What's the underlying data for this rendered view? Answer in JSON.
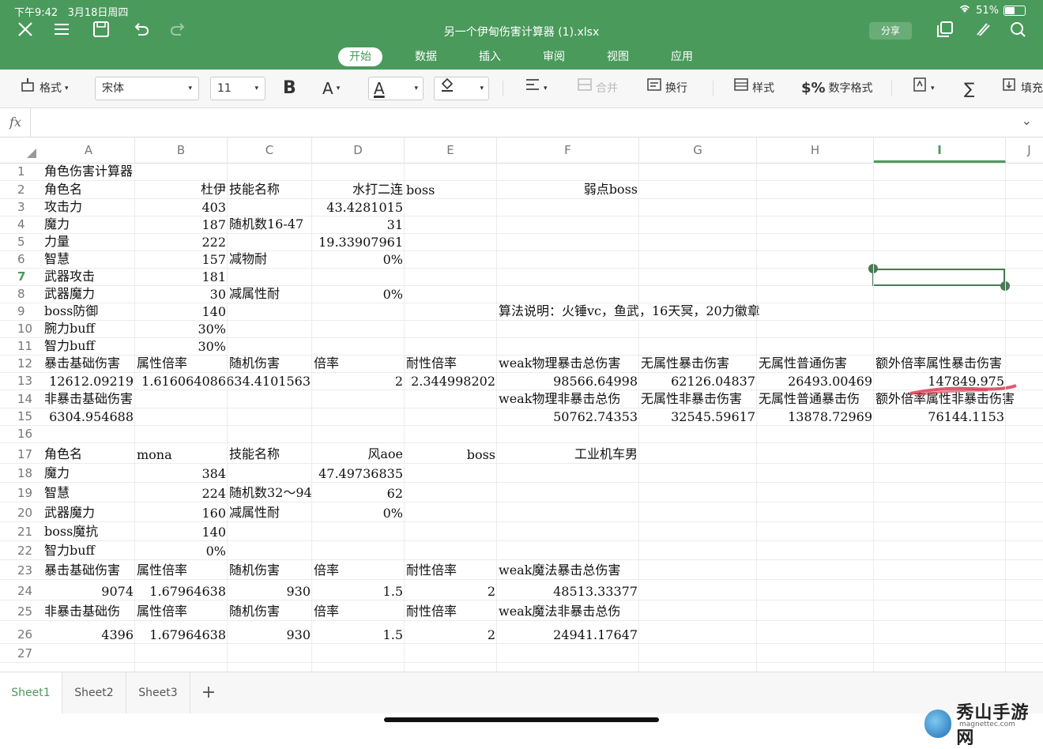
{
  "status": {
    "time": "下午9:42",
    "date": "3月18日周四",
    "battery": "51%"
  },
  "title_bar": {
    "doc_title": "另一个伊甸伤害计算器 (1).xlsx",
    "share_label": "分享"
  },
  "tabs": [
    "开始",
    "数据",
    "插入",
    "审阅",
    "视图",
    "应用"
  ],
  "toolbar": {
    "format_label": "格式",
    "font": "宋体",
    "font_size": "11",
    "bold": "B",
    "font_size_adjust": "A",
    "font_color": "A",
    "merge_label": "合并",
    "wrap_label": "换行",
    "style_label": "样式",
    "number_format_label": "数字格式",
    "fill_label": "填充"
  },
  "formula_bar": {
    "label": "fx",
    "value": ""
  },
  "columns": [
    "A",
    "B",
    "C",
    "D",
    "E",
    "F",
    "G",
    "H",
    "I",
    "J"
  ],
  "selected": {
    "column": "I",
    "row": "7"
  },
  "rows": [
    {
      "n": "1",
      "cells": [
        {
          "c": "A",
          "v": "角色伤害计算器"
        }
      ]
    },
    {
      "n": "2",
      "cells": [
        {
          "c": "A",
          "v": "角色名"
        },
        {
          "c": "B",
          "v": "杜伊",
          "r": true
        },
        {
          "c": "C",
          "v": "技能名称"
        },
        {
          "c": "D",
          "v": "水打二连",
          "r": true
        },
        {
          "c": "E",
          "v": "boss"
        },
        {
          "c": "F",
          "v": "弱点boss",
          "r": true
        }
      ]
    },
    {
      "n": "3",
      "cells": [
        {
          "c": "A",
          "v": "攻击力"
        },
        {
          "c": "B",
          "v": "403",
          "r": true
        },
        {
          "c": "D",
          "v": "43.4281015",
          "r": true
        }
      ]
    },
    {
      "n": "4",
      "cells": [
        {
          "c": "A",
          "v": "魔力"
        },
        {
          "c": "B",
          "v": "187",
          "r": true
        },
        {
          "c": "C",
          "v": "随机数16-47"
        },
        {
          "c": "D",
          "v": "31",
          "r": true
        }
      ]
    },
    {
      "n": "5",
      "cells": [
        {
          "c": "A",
          "v": "力量"
        },
        {
          "c": "B",
          "v": "222",
          "r": true
        },
        {
          "c": "D",
          "v": "19.33907961",
          "r": true
        }
      ]
    },
    {
      "n": "6",
      "cells": [
        {
          "c": "A",
          "v": "智慧"
        },
        {
          "c": "B",
          "v": "157",
          "r": true
        },
        {
          "c": "C",
          "v": "减物耐"
        },
        {
          "c": "D",
          "v": "0%",
          "r": true
        }
      ]
    },
    {
      "n": "7",
      "cells": [
        {
          "c": "A",
          "v": "武器攻击"
        },
        {
          "c": "B",
          "v": "181",
          "r": true
        }
      ]
    },
    {
      "n": "8",
      "cells": [
        {
          "c": "A",
          "v": "武器魔力"
        },
        {
          "c": "B",
          "v": "30",
          "r": true
        },
        {
          "c": "C",
          "v": "减属性耐"
        },
        {
          "c": "D",
          "v": "0%",
          "r": true
        }
      ]
    },
    {
      "n": "9",
      "cells": [
        {
          "c": "A",
          "v": "boss防御"
        },
        {
          "c": "B",
          "v": "140",
          "r": true
        },
        {
          "c": "F",
          "v": "算法说明：火锤vc，鱼武，16天冥，20力徽章"
        }
      ]
    },
    {
      "n": "10",
      "cells": [
        {
          "c": "A",
          "v": "腕力buff"
        },
        {
          "c": "B",
          "v": "30%",
          "r": true
        }
      ]
    },
    {
      "n": "11",
      "cells": [
        {
          "c": "A",
          "v": "智力buff"
        },
        {
          "c": "B",
          "v": "30%",
          "r": true
        }
      ]
    },
    {
      "n": "12",
      "cells": [
        {
          "c": "A",
          "v": "暴击基础伤害"
        },
        {
          "c": "B",
          "v": "属性倍率"
        },
        {
          "c": "C",
          "v": "随机伤害"
        },
        {
          "c": "D",
          "v": "倍率"
        },
        {
          "c": "E",
          "v": "耐性倍率"
        },
        {
          "c": "F",
          "v": "weak物理暴击总伤害"
        },
        {
          "c": "G",
          "v": "无属性暴击伤害"
        },
        {
          "c": "H",
          "v": "无属性普通伤害"
        },
        {
          "c": "I",
          "v": "额外倍率属性暴击伤害"
        }
      ]
    },
    {
      "n": "13",
      "cells": [
        {
          "c": "A",
          "v": "12612.09219",
          "r": true
        },
        {
          "c": "B",
          "v": "1.616064086",
          "r": true
        },
        {
          "c": "C",
          "v": "634.4101563",
          "r": true
        },
        {
          "c": "D",
          "v": "2",
          "r": true
        },
        {
          "c": "E",
          "v": "2.344998202",
          "r": true
        },
        {
          "c": "F",
          "v": "98566.64998",
          "r": true
        },
        {
          "c": "G",
          "v": "62126.04837",
          "r": true
        },
        {
          "c": "H",
          "v": "26493.00469",
          "r": true
        },
        {
          "c": "I",
          "v": "147849.975",
          "r": true
        }
      ]
    },
    {
      "n": "14",
      "cells": [
        {
          "c": "A",
          "v": "非暴击基础伤害"
        },
        {
          "c": "F",
          "v": "weak物理非暴击总伤"
        },
        {
          "c": "G",
          "v": "无属性非暴击伤害"
        },
        {
          "c": "H",
          "v": "无属性普通暴击伤"
        },
        {
          "c": "I",
          "v": "额外倍率属性非暴击伤害"
        }
      ]
    },
    {
      "n": "15",
      "cells": [
        {
          "c": "A",
          "v": "6304.954688",
          "r": true
        },
        {
          "c": "F",
          "v": "50762.74353",
          "r": true
        },
        {
          "c": "G",
          "v": "32545.59617",
          "r": true
        },
        {
          "c": "H",
          "v": "13878.72969",
          "r": true
        },
        {
          "c": "I",
          "v": "76144.1153",
          "r": true
        }
      ]
    },
    {
      "n": "16",
      "cells": []
    },
    {
      "n": "17",
      "cells": [
        {
          "c": "A",
          "v": "角色名"
        },
        {
          "c": "B",
          "v": "mona"
        },
        {
          "c": "C",
          "v": "技能名称"
        },
        {
          "c": "D",
          "v": "风aoe",
          "r": true
        },
        {
          "c": "E",
          "v": "boss",
          "r": true
        },
        {
          "c": "F",
          "v": "工业机车男",
          "r": true
        }
      ]
    },
    {
      "n": "18",
      "cells": [
        {
          "c": "A",
          "v": "魔力"
        },
        {
          "c": "B",
          "v": "384",
          "r": true
        },
        {
          "c": "D",
          "v": "47.49736835",
          "r": true
        }
      ]
    },
    {
      "n": "19",
      "cells": [
        {
          "c": "A",
          "v": "智慧"
        },
        {
          "c": "B",
          "v": "224",
          "r": true
        },
        {
          "c": "C",
          "v": "随机数32～94"
        },
        {
          "c": "D",
          "v": "62",
          "r": true
        }
      ]
    },
    {
      "n": "20",
      "cells": [
        {
          "c": "A",
          "v": "武器魔力"
        },
        {
          "c": "B",
          "v": "160",
          "r": true
        },
        {
          "c": "C",
          "v": "减属性耐"
        },
        {
          "c": "D",
          "v": "0%",
          "r": true
        }
      ]
    },
    {
      "n": "21",
      "cells": [
        {
          "c": "A",
          "v": "boss魔抗"
        },
        {
          "c": "B",
          "v": "140",
          "r": true
        }
      ]
    },
    {
      "n": "22",
      "cells": [
        {
          "c": "A",
          "v": "智力buff"
        },
        {
          "c": "B",
          "v": "0%",
          "r": true
        }
      ]
    },
    {
      "n": "23",
      "cells": [
        {
          "c": "A",
          "v": "暴击基础伤害"
        },
        {
          "c": "B",
          "v": "属性倍率"
        },
        {
          "c": "C",
          "v": "随机伤害"
        },
        {
          "c": "D",
          "v": "倍率"
        },
        {
          "c": "E",
          "v": "耐性倍率"
        },
        {
          "c": "F",
          "v": "weak魔法暴击总伤害"
        }
      ]
    },
    {
      "n": "24",
      "cells": [
        {
          "c": "A",
          "v": "9074",
          "r": true
        },
        {
          "c": "B",
          "v": "1.67964638",
          "r": true
        },
        {
          "c": "C",
          "v": "930",
          "r": true
        },
        {
          "c": "D",
          "v": "1.5",
          "r": true
        },
        {
          "c": "E",
          "v": "2",
          "r": true
        },
        {
          "c": "F",
          "v": "48513.33377",
          "r": true
        }
      ]
    },
    {
      "n": "25",
      "cells": [
        {
          "c": "A",
          "v": "非暴击基础伤"
        },
        {
          "c": "B",
          "v": "属性倍率"
        },
        {
          "c": "C",
          "v": "随机伤害"
        },
        {
          "c": "D",
          "v": "倍率"
        },
        {
          "c": "E",
          "v": "耐性倍率"
        },
        {
          "c": "F",
          "v": "weak魔法非暴击总伤"
        }
      ]
    },
    {
      "n": "26",
      "cells": [
        {
          "c": "A",
          "v": "4396",
          "r": true
        },
        {
          "c": "B",
          "v": "1.67964638",
          "r": true
        },
        {
          "c": "C",
          "v": "930",
          "r": true
        },
        {
          "c": "D",
          "v": "1.5",
          "r": true
        },
        {
          "c": "E",
          "v": "2",
          "r": true
        },
        {
          "c": "F",
          "v": "24941.17647",
          "r": true
        }
      ]
    },
    {
      "n": "27",
      "cells": []
    }
  ],
  "sheets": [
    "Sheet1",
    "Sheet2",
    "Sheet3"
  ],
  "add_sheet": "+",
  "watermark": {
    "text": "秀山手游网",
    "sub": "magnettec.com"
  },
  "colors": {
    "accent": "#4a9a5c",
    "selection": "#4a7a55"
  }
}
